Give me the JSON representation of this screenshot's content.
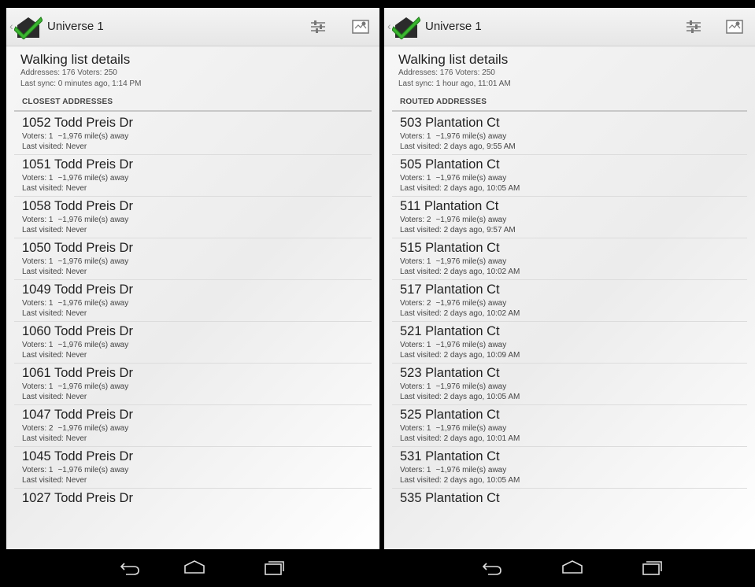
{
  "left": {
    "app_title": "Universe 1",
    "details": {
      "title": "Walking list details",
      "counts": "Addresses: 176 Voters: 250",
      "sync": "Last sync: 0 minutes ago, 1:14 PM"
    },
    "section_header": "CLOSEST ADDRESSES",
    "items": [
      {
        "address": "1052 Todd Preis Dr",
        "voters": "Voters: 1",
        "distance": "~1,976 mile(s) away",
        "visited": "Last visited: Never"
      },
      {
        "address": "1051 Todd Preis Dr",
        "voters": "Voters: 1",
        "distance": "~1,976 mile(s) away",
        "visited": "Last visited: Never"
      },
      {
        "address": "1058 Todd Preis Dr",
        "voters": "Voters: 1",
        "distance": "~1,976 mile(s) away",
        "visited": "Last visited: Never"
      },
      {
        "address": "1050 Todd Preis Dr",
        "voters": "Voters: 1",
        "distance": "~1,976 mile(s) away",
        "visited": "Last visited: Never"
      },
      {
        "address": "1049 Todd Preis Dr",
        "voters": "Voters: 1",
        "distance": "~1,976 mile(s) away",
        "visited": "Last visited: Never"
      },
      {
        "address": "1060 Todd Preis Dr",
        "voters": "Voters: 1",
        "distance": "~1,976 mile(s) away",
        "visited": "Last visited: Never"
      },
      {
        "address": "1061 Todd Preis Dr",
        "voters": "Voters: 1",
        "distance": "~1,976 mile(s) away",
        "visited": "Last visited: Never"
      },
      {
        "address": "1047 Todd Preis Dr",
        "voters": "Voters: 2",
        "distance": "~1,976 mile(s) away",
        "visited": "Last visited: Never"
      },
      {
        "address": "1045 Todd Preis Dr",
        "voters": "Voters: 1",
        "distance": "~1,976 mile(s) away",
        "visited": "Last visited: Never"
      },
      {
        "address": "1027 Todd Preis Dr",
        "voters": "",
        "distance": "",
        "visited": ""
      }
    ]
  },
  "right": {
    "app_title": "Universe 1",
    "details": {
      "title": "Walking list details",
      "counts": "Addresses: 176 Voters: 250",
      "sync": "Last sync: 1 hour ago, 11:01 AM"
    },
    "section_header": "ROUTED ADDRESSES",
    "items": [
      {
        "address": "503 Plantation Ct",
        "voters": "Voters: 1",
        "distance": "~1,976 mile(s) away",
        "visited": "Last visited: 2 days ago, 9:55 AM"
      },
      {
        "address": "505 Plantation Ct",
        "voters": "Voters: 1",
        "distance": "~1,976 mile(s) away",
        "visited": "Last visited: 2 days ago, 10:05 AM"
      },
      {
        "address": "511 Plantation Ct",
        "voters": "Voters: 2",
        "distance": "~1,976 mile(s) away",
        "visited": "Last visited: 2 days ago, 9:57 AM"
      },
      {
        "address": "515 Plantation Ct",
        "voters": "Voters: 1",
        "distance": "~1,976 mile(s) away",
        "visited": "Last visited: 2 days ago, 10:02 AM"
      },
      {
        "address": "517 Plantation Ct",
        "voters": "Voters: 2",
        "distance": "~1,976 mile(s) away",
        "visited": "Last visited: 2 days ago, 10:02 AM"
      },
      {
        "address": "521 Plantation Ct",
        "voters": "Voters: 1",
        "distance": "~1,976 mile(s) away",
        "visited": "Last visited: 2 days ago, 10:09 AM"
      },
      {
        "address": "523 Plantation Ct",
        "voters": "Voters: 1",
        "distance": "~1,976 mile(s) away",
        "visited": "Last visited: 2 days ago, 10:05 AM"
      },
      {
        "address": "525 Plantation Ct",
        "voters": "Voters: 1",
        "distance": "~1,976 mile(s) away",
        "visited": "Last visited: 2 days ago, 10:01 AM"
      },
      {
        "address": "531 Plantation Ct",
        "voters": "Voters: 1",
        "distance": "~1,976 mile(s) away",
        "visited": "Last visited: 2 days ago, 10:05 AM"
      },
      {
        "address": "535 Plantation Ct",
        "voters": "",
        "distance": "",
        "visited": ""
      }
    ]
  },
  "icons": {
    "app_logo": "checkmark-house-icon",
    "filter": "sliders-icon",
    "map": "map-icon",
    "back": "back-icon",
    "home": "home-icon",
    "recents": "recent-apps-icon"
  },
  "colors": {
    "logo_green": "#3cb531",
    "logo_dark": "#2b2b2b",
    "divider": "#c8c8c8"
  }
}
